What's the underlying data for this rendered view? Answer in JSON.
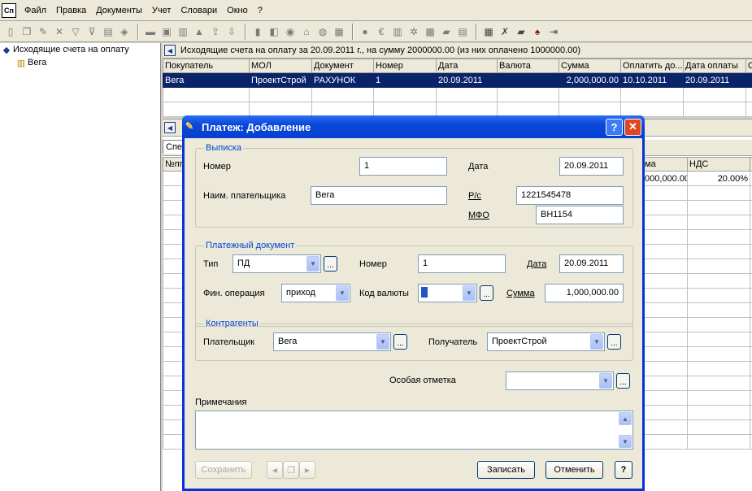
{
  "menubar": {
    "app_icon": "Сп",
    "items": [
      "Файл",
      "Правка",
      "Документы",
      "Учет",
      "Словари",
      "Окно",
      "?"
    ]
  },
  "tree": {
    "root_label": "Исходящие счета на оплату",
    "child_label": "Вега"
  },
  "invoices": {
    "caption": "Исходящие счета на оплату за 20.09.2011 г., на сумму 2000000.00 (из них оплачено 1000000.00)",
    "columns": [
      "Покупатель",
      "МОЛ",
      "Документ",
      "Номер",
      "Дата",
      "Валюта",
      "Сумма",
      "Оплатить до...",
      "Дата оплаты",
      "Оп"
    ],
    "rows": [
      [
        "Вега",
        "ПроектСтрой",
        "РАХУНОК",
        "1",
        "20.09.2011",
        "",
        "2,000,000.00",
        "10.10.2011",
        "20.09.2011",
        ""
      ]
    ]
  },
  "spec": {
    "tab_label": "Спец",
    "columns": [
      "№пп",
      "ма",
      "НДС"
    ],
    "first_row": [
      "",
      "000,000.00",
      "20.00%"
    ]
  },
  "dialog": {
    "title": "Платеж: Добавление",
    "help_label": "?",
    "close_label": "✕",
    "statement": {
      "legend": "Выписка",
      "number_label": "Номер",
      "number_value": "1",
      "date_label": "Дата",
      "date_value": "20.09.2011",
      "payer_name_label": "Наим. плательщика",
      "payer_name_value": "Вега",
      "account_label": "Р/с",
      "account_value": "1221545478",
      "mfo_label": "МФО",
      "mfo_value": "ВН1154"
    },
    "payment_doc": {
      "legend": "Платежный документ",
      "type_label": "Тип",
      "type_value": "ПД",
      "number_label": "Номер",
      "number_value": "1",
      "date_label": "Дата",
      "date_value": "20.09.2011",
      "fin_op_label": "Фин. операция",
      "fin_op_value": "приход",
      "currency_label": "Код валюты",
      "amount_label": "Сумма",
      "amount_value": "1,000,000.00"
    },
    "counterparties": {
      "legend": "Контрагенты",
      "payer_label": "Плательщик",
      "payer_value": "Вега",
      "recipient_label": "Получатель",
      "recipient_value": "ПроектСтрой"
    },
    "special_mark_label": "Особая отметка",
    "special_mark_value": "",
    "notes_label": "Примечания",
    "notes_value": "",
    "buttons": {
      "save": "Сохранить",
      "record": "Записать",
      "cancel": "Отменить",
      "help": "?"
    }
  }
}
